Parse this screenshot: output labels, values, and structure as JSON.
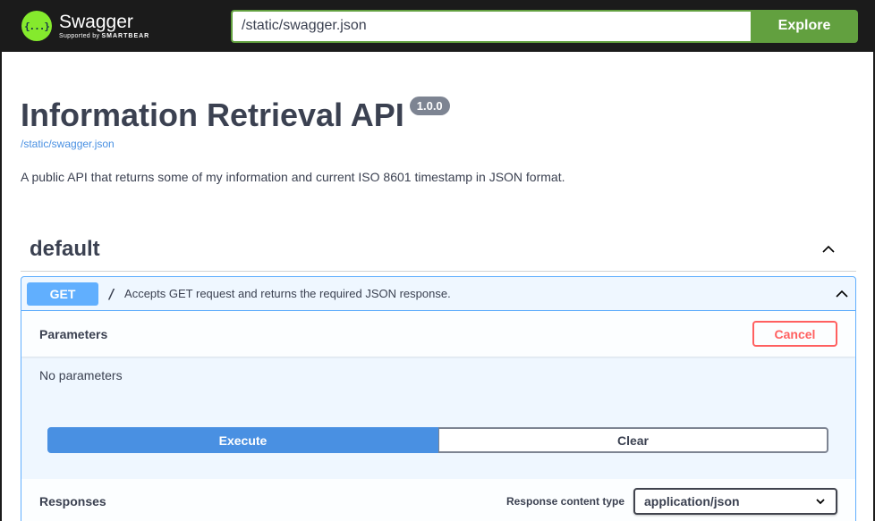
{
  "topbar": {
    "brand_name": "Swagger",
    "brand_sub_prefix": "Supported by",
    "brand_sub_name": "SMARTBEAR",
    "logo_glyph": "{...}",
    "url_value": "/static/swagger.json",
    "explore_label": "Explore"
  },
  "info": {
    "title": "Information Retrieval API",
    "version": "1.0.0",
    "spec_link": "/static/swagger.json",
    "description": "A public API that returns some of my information and current ISO 8601 timestamp in JSON format."
  },
  "tag": {
    "name": "default",
    "chevron_icon": "chevron-up-icon"
  },
  "operation": {
    "method": "GET",
    "path": "/",
    "summary": "Accepts GET request and returns the required JSON response.",
    "chevron_icon": "chevron-up-icon",
    "parameters_title": "Parameters",
    "cancel_label": "Cancel",
    "no_parameters": "No parameters",
    "execute_label": "Execute",
    "clear_label": "Clear",
    "responses_title": "Responses",
    "response_content_type_label": "Response content type",
    "response_content_type_value": "application/json"
  },
  "colors": {
    "topbar_bg": "#1b1b1b",
    "brand_green": "#85ea2d",
    "explore_green": "#62a03f",
    "get_blue": "#61affe",
    "execute_blue": "#4990e2",
    "cancel_red": "#ff6060",
    "text": "#3b4151"
  }
}
